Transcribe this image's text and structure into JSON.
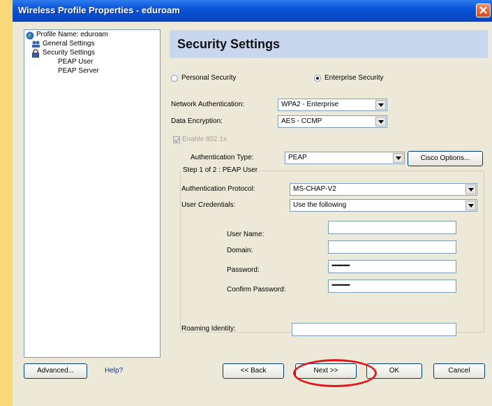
{
  "window": {
    "title": "Wireless Profile Properties - eduroam"
  },
  "tree": {
    "items": [
      {
        "label": "Profile Name: eduroam"
      },
      {
        "label": "General Settings"
      },
      {
        "label": "Security Settings"
      },
      {
        "label": "PEAP User"
      },
      {
        "label": "PEAP Server"
      }
    ]
  },
  "header": {
    "title": "Security Settings"
  },
  "security": {
    "personal_label": "Personal Security",
    "enterprise_label": "Enterprise Security",
    "selected": "Enterprise Security"
  },
  "network_auth": {
    "label": "Network Authentication:",
    "value": "WPA2 - Enterprise"
  },
  "data_encryption": {
    "label": "Data Encryption:",
    "value": "AES - CCMP"
  },
  "enable_8021x": {
    "label": "Enable 802.1x",
    "checked": true,
    "disabled": true
  },
  "auth_type": {
    "label": "Authentication Type:",
    "value": "PEAP",
    "cisco_options_label": "Cisco Options..."
  },
  "step_group": {
    "title": "Step 1 of 2 : PEAP User"
  },
  "auth_protocol": {
    "label": "Authentication Protocol:",
    "value": "MS-CHAP-V2"
  },
  "user_credentials": {
    "label": "User Credentials:",
    "value": "Use the following"
  },
  "user_name": {
    "label": "User Name:",
    "value": ""
  },
  "domain": {
    "label": "Domain:",
    "value": ""
  },
  "password": {
    "label": "Password:",
    "value": "••••••••••••"
  },
  "confirm_password": {
    "label": "Confirm Password:",
    "value": "••••••••••••"
  },
  "roaming_identity": {
    "label": "Roaming Identity:",
    "value": ""
  },
  "footer": {
    "advanced_label": "Advanced...",
    "help_label": "Help?",
    "back_label": "<< Back",
    "next_label": "Next >>",
    "ok_label": "OK",
    "cancel_label": "Cancel"
  },
  "colors": {
    "titlebar": "#0a55d8",
    "header_bg": "#c8d6ee",
    "annotation_circle": "#e0181e"
  }
}
